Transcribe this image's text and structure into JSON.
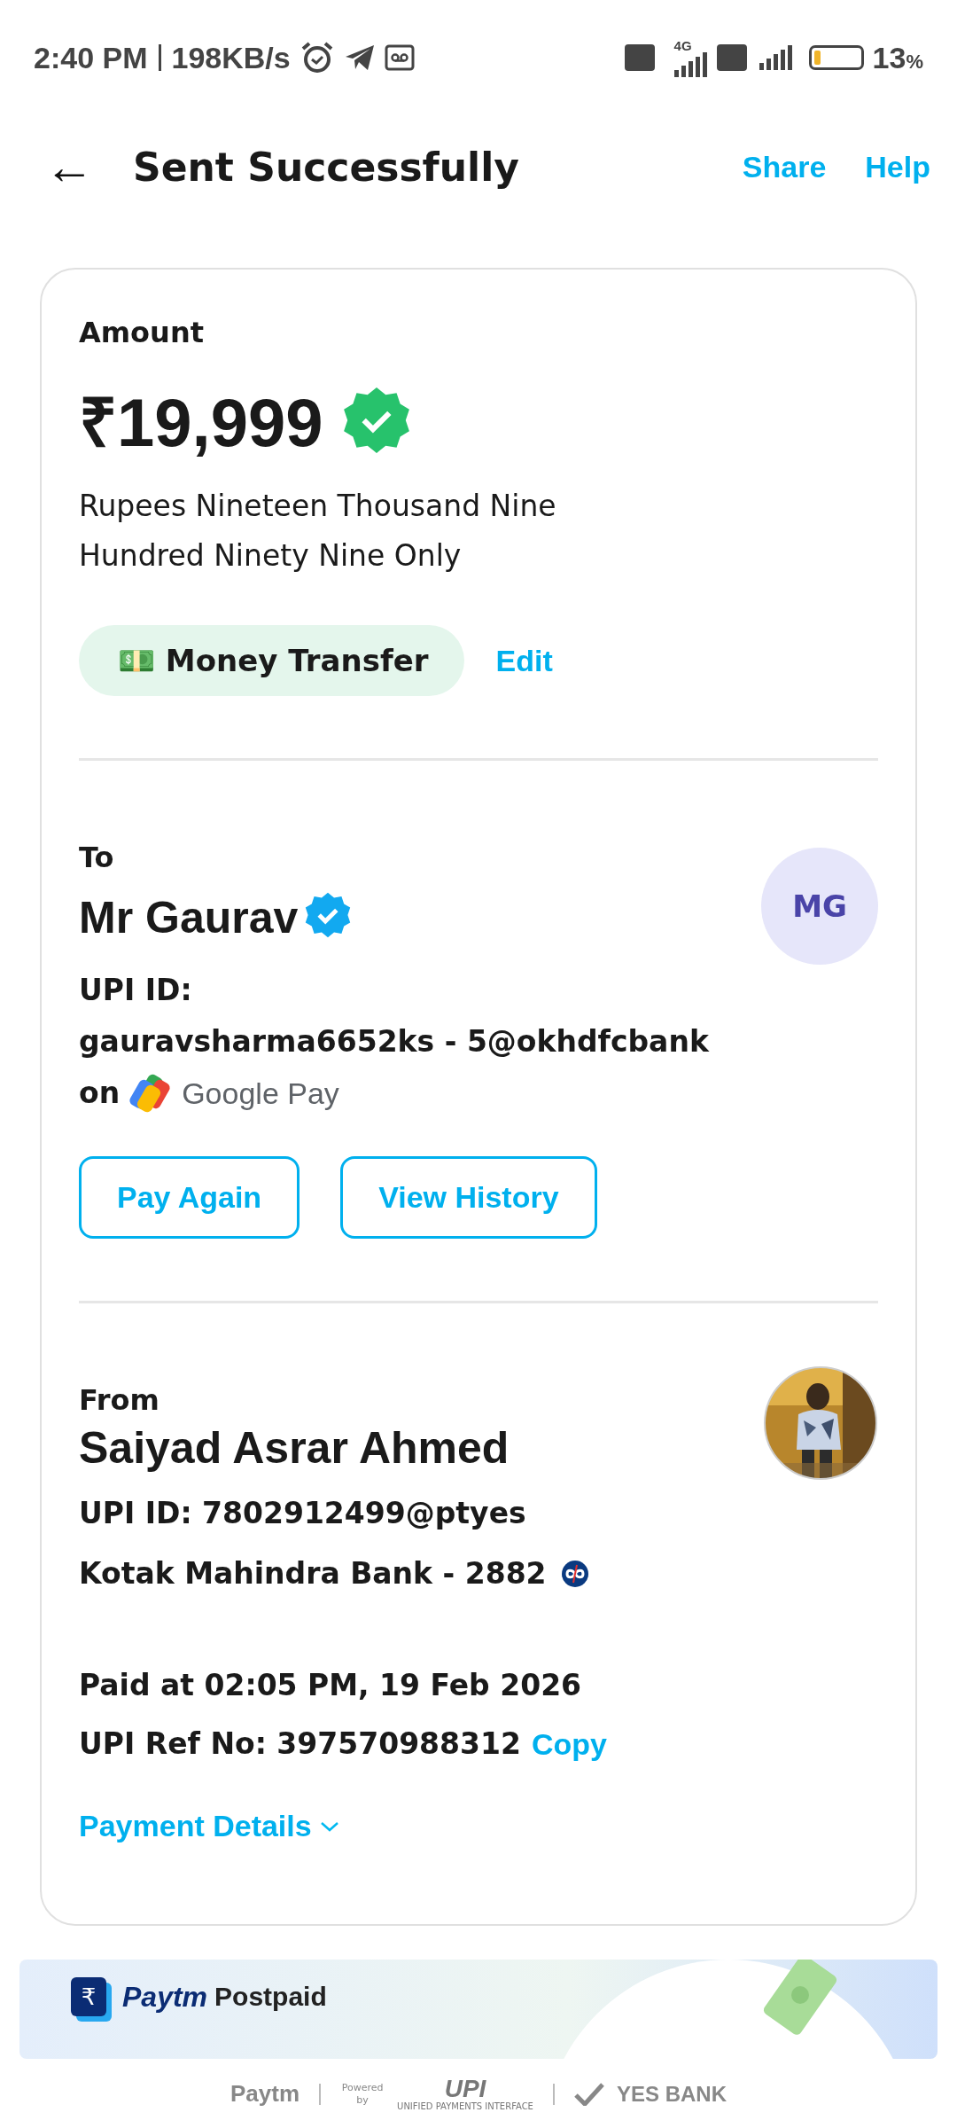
{
  "status_bar": {
    "time": "2:40 PM",
    "speed": "198KB/s",
    "network_1": "4G",
    "battery": "13",
    "battery_unit": "%"
  },
  "header": {
    "back": "←",
    "title": "Sent Successfully",
    "actions": [
      "Share",
      "Help"
    ]
  },
  "amount": {
    "label": "Amount",
    "value": "₹19,999",
    "words": "Rupees Nineteen Thousand Nine Hundred Ninety Nine Only",
    "category": "💵 Money Transfer",
    "edit": "Edit"
  },
  "to": {
    "label": "To",
    "name": "Mr Gaurav",
    "initials": "MG",
    "upi_label": "UPI ID:",
    "upi_id": "gauravsharma6652ks - 5@okhdfcbank",
    "on": "on",
    "app": "Google Pay",
    "buttons": [
      "Pay Again",
      "View History"
    ]
  },
  "from": {
    "label": "From",
    "name": "Saiyad Asrar Ahmed",
    "upi": "UPI ID: 7802912499@ptyes",
    "bank": "Kotak Mahindra Bank - 2882",
    "paid_at": "Paid at 02:05 PM, 19 Feb 2026",
    "ref_label": "UPI Ref No: 397570988312",
    "copy": "Copy",
    "details": "Payment Details"
  },
  "banner": {
    "brand": "Paytm",
    "product": "Postpaid",
    "icon": "₹"
  },
  "footer": {
    "paytm": "Paytm",
    "powered": "Powered by",
    "upi": "UPI",
    "upi_sub": "UNIFIED PAYMENTS INTERFACE",
    "bank": "YES BANK"
  }
}
